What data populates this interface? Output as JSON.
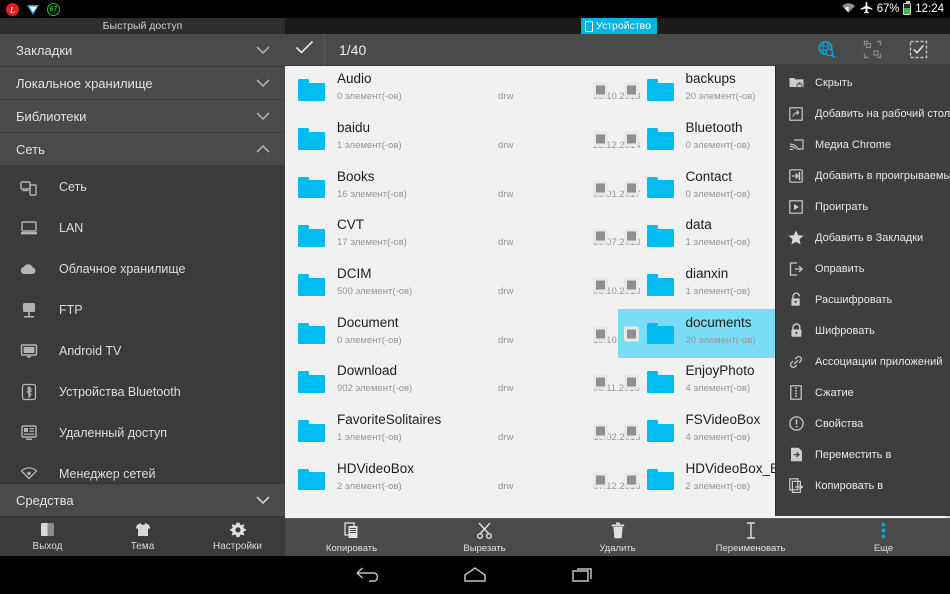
{
  "statusbar": {
    "left_icons": [
      "app-red-icon",
      "app-blue-icon",
      "counter-badge-icon"
    ],
    "badge_text": "67",
    "battery_percent": "67%",
    "time": "12:24",
    "icons": [
      "wifi-icon",
      "airplane-icon",
      "battery-icon"
    ]
  },
  "sidebar": {
    "title": "Быстрый доступ",
    "categories": [
      {
        "label": "Закладки",
        "expanded": false
      },
      {
        "label": "Локальное хранилище",
        "expanded": false
      },
      {
        "label": "Библиотеки",
        "expanded": false
      },
      {
        "label": "Сеть",
        "expanded": true
      }
    ],
    "network_items": [
      {
        "label": "Сеть",
        "icon": "network-icon"
      },
      {
        "label": "LAN",
        "icon": "lan-icon"
      },
      {
        "label": "Облачное хранилище",
        "icon": "cloud-icon"
      },
      {
        "label": "FTP",
        "icon": "ftp-server-icon"
      },
      {
        "label": "Android TV",
        "icon": "tv-icon"
      },
      {
        "label": "Устройства Bluetooth",
        "icon": "bluetooth-icon"
      },
      {
        "label": "Удаленный доступ",
        "icon": "remote-access-icon"
      },
      {
        "label": "Менеджер сетей",
        "icon": "network-manager-icon"
      }
    ],
    "bottom_category": {
      "label": "Средства",
      "expanded": false
    },
    "actions": [
      {
        "label": "Выход",
        "icon": "exit-icon"
      },
      {
        "label": "Тема",
        "icon": "theme-shirt-icon"
      },
      {
        "label": "Настройки",
        "icon": "gear-icon"
      }
    ]
  },
  "main": {
    "tab": {
      "label": "Устройство",
      "icon": "device-icon",
      "color": "#00b5e2"
    },
    "toolbar": {
      "check_icon": "checkmark-icon",
      "selection_count": "1/40",
      "icons": [
        {
          "name": "globe-search-icon",
          "color": "#00a8d8"
        },
        {
          "name": "multi-select-icon",
          "color": "#8a8a8a"
        },
        {
          "name": "select-all-icon",
          "color": "#c8c8c8"
        }
      ]
    },
    "column_left": [
      {
        "name": "Audio",
        "count": "0 элемент(-ов)",
        "perm": "drw",
        "date": "05.10.2018",
        "selected": false
      },
      {
        "name": "baidu",
        "count": "1 элемент(-ов)",
        "perm": "drw",
        "date": "25.12.2014",
        "selected": false
      },
      {
        "name": "Books",
        "count": "16 элемент(-ов)",
        "perm": "drw",
        "date": "08.01.2017",
        "selected": false
      },
      {
        "name": "CVT",
        "count": "17 элемент(-ов)",
        "perm": "drw",
        "date": "30.07.2018",
        "selected": false
      },
      {
        "name": "DCIM",
        "count": "500 элемент(-ов)",
        "perm": "drw",
        "date": "08.10.2018",
        "selected": false
      },
      {
        "name": "Document",
        "count": "0 элемент(-ов)",
        "perm": "drw",
        "date": "19.10.2018",
        "selected": false
      },
      {
        "name": "Download",
        "count": "902 элемент(-ов)",
        "perm": "drw",
        "date": "08.11.2018",
        "selected": false
      },
      {
        "name": "FavoriteSolitaires",
        "count": "1 элемент(-ов)",
        "perm": "drw",
        "date": "10.02.2016",
        "selected": false
      },
      {
        "name": "HDVideoBox",
        "count": "2 элемент(-ов)",
        "perm": "drw",
        "date": "07.12.2016",
        "selected": false
      }
    ],
    "column_right": [
      {
        "name": "backups",
        "count": "20 элемент(-ов)",
        "selected": false
      },
      {
        "name": "Bluetooth",
        "count": "0 элемент(-ов)",
        "selected": false
      },
      {
        "name": "Contact",
        "count": "0 элемент(-ов)",
        "selected": false
      },
      {
        "name": "data",
        "count": "1 элемент(-ов)",
        "selected": false
      },
      {
        "name": "dianxin",
        "count": "1 элемент(-ов)",
        "selected": false
      },
      {
        "name": "documents",
        "count": "20 элемент(-ов)",
        "selected": true
      },
      {
        "name": "EnjoyPhoto",
        "count": "4 элемент(-ов)",
        "selected": false
      },
      {
        "name": "FSVideoBox",
        "count": "4 элемент(-ов)",
        "selected": false
      },
      {
        "name": "HDVideoBox_BETA",
        "count": "2 элемент(-ов)",
        "selected": false
      }
    ],
    "folder_color": "#00bcf0",
    "selected_row_color": "#7adcf5",
    "actions": [
      {
        "label": "Копировать",
        "icon": "copy-icon"
      },
      {
        "label": "Вырезать",
        "icon": "cut-scissors-icon"
      },
      {
        "label": "Удалить",
        "icon": "trash-icon"
      },
      {
        "label": "Переименовать",
        "icon": "rename-cursor-icon"
      },
      {
        "label": "Еще",
        "icon": "more-vertical-icon"
      }
    ]
  },
  "context_menu": {
    "items": [
      {
        "label": "Скрыть",
        "icon": "hide-folder-icon"
      },
      {
        "label": "Добавить на рабочий стол",
        "icon": "shortcut-icon"
      },
      {
        "label": "Медиа Chrome",
        "icon": "cast-icon"
      },
      {
        "label": "Добавить в проигрываемые",
        "icon": "add-to-playlist-icon"
      },
      {
        "label": "Проиграть",
        "icon": "play-icon"
      },
      {
        "label": "Добавить в Закладки",
        "icon": "star-icon"
      },
      {
        "label": "Оправить",
        "icon": "send-icon"
      },
      {
        "label": "Расшифровать",
        "icon": "unlock-icon"
      },
      {
        "label": "Шифровать",
        "icon": "lock-icon"
      },
      {
        "label": "Ассоциации приложений",
        "icon": "link-icon"
      },
      {
        "label": "Сжатие",
        "icon": "archive-icon"
      },
      {
        "label": "Свойства",
        "icon": "info-icon"
      },
      {
        "label": "Переместить в",
        "icon": "move-file-icon"
      },
      {
        "label": "Копировать в",
        "icon": "copy-to-icon"
      }
    ]
  },
  "navbar": {
    "buttons": [
      {
        "name": "back-button",
        "icon": "back-arrow-icon"
      },
      {
        "name": "home-button",
        "icon": "home-icon"
      },
      {
        "name": "recents-button",
        "icon": "recents-icon"
      }
    ]
  }
}
